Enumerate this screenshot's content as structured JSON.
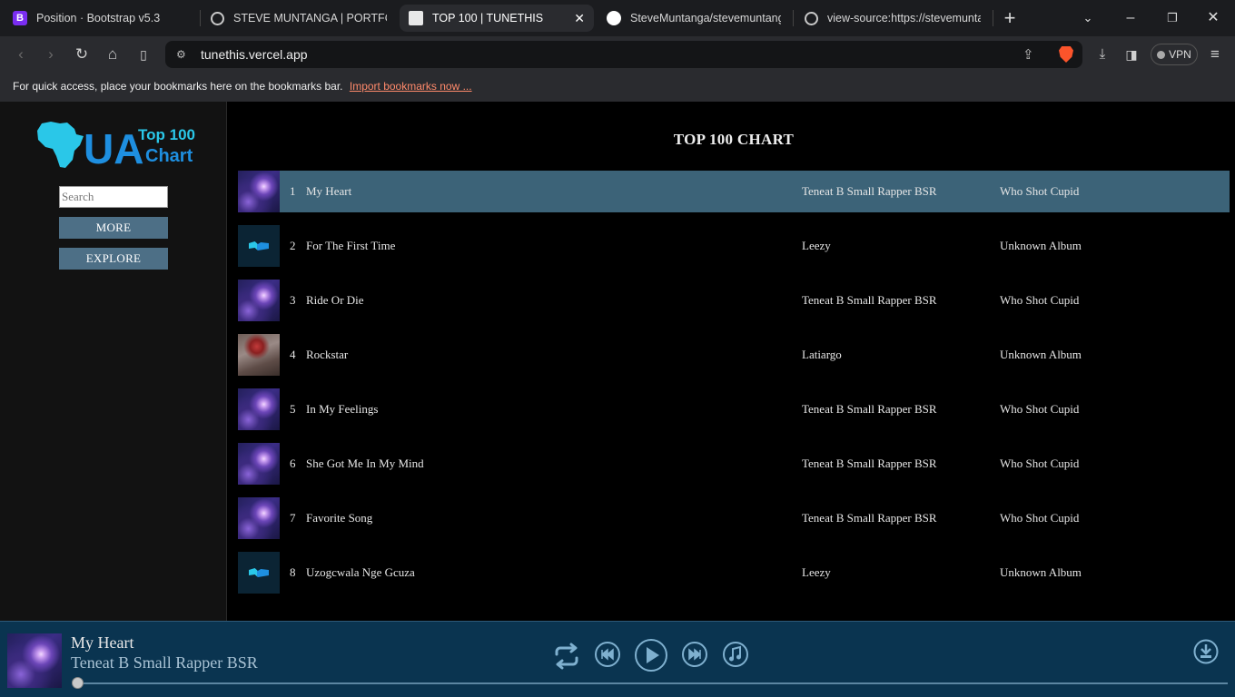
{
  "browser": {
    "tabs": [
      {
        "title": "Position · Bootstrap v5.3",
        "icon": "bootstrap-icon"
      },
      {
        "title": "STEVE MUNTANGA | PORTFOLIO",
        "icon": "globe-icon"
      },
      {
        "title": "TOP 100 | TUNETHIS",
        "icon": "site-icon",
        "active": true
      },
      {
        "title": "SteveMuntanga/stevemuntanga",
        "icon": "github-icon"
      },
      {
        "title": "view-source:https://stevemuntang",
        "icon": "globe-icon"
      }
    ],
    "url": "tunethis.vercel.app",
    "vpn_label": "VPN",
    "bookmarks_text": "For quick access, place your bookmarks here on the bookmarks bar.",
    "bookmarks_link": "Import bookmarks now ..."
  },
  "sidebar": {
    "logo": {
      "letters": "UA",
      "line1": "Top 100",
      "line2": "Chart"
    },
    "search_placeholder": "Search",
    "buttons": [
      "MORE",
      "EXPLORE"
    ]
  },
  "main": {
    "title": "TOP 100 CHART",
    "tracks": [
      {
        "num": "1",
        "title": "My Heart",
        "artist": "Teneat B Small Rapper BSR",
        "album": "Who Shot Cupid",
        "art": "galaxy",
        "active": true
      },
      {
        "num": "2",
        "title": "For The First Time",
        "artist": "Leezy",
        "album": "Unknown Album",
        "art": "logo"
      },
      {
        "num": "3",
        "title": "Ride Or Die",
        "artist": "Teneat B Small Rapper BSR",
        "album": "Who Shot Cupid",
        "art": "galaxy"
      },
      {
        "num": "4",
        "title": "Rockstar",
        "artist": "Latiargo",
        "album": "Unknown Album",
        "art": "rock"
      },
      {
        "num": "5",
        "title": "In My Feelings",
        "artist": "Teneat B Small Rapper BSR",
        "album": "Who Shot Cupid",
        "art": "galaxy"
      },
      {
        "num": "6",
        "title": "She Got Me In My Mind",
        "artist": "Teneat B Small Rapper BSR",
        "album": "Who Shot Cupid",
        "art": "galaxy"
      },
      {
        "num": "7",
        "title": "Favorite Song",
        "artist": "Teneat B Small Rapper BSR",
        "album": "Who Shot Cupid",
        "art": "galaxy"
      },
      {
        "num": "8",
        "title": "Uzogcwala Nge Gcuza",
        "artist": "Leezy",
        "album": "Unknown Album",
        "art": "logo"
      }
    ]
  },
  "player": {
    "title": "My Heart",
    "artist": "Teneat B Small Rapper BSR",
    "progress": 0
  },
  "colors": {
    "active_row": "#3c6378",
    "player_bg": "#0a3450",
    "button_bg": "#4d6f86",
    "logo_cyan": "#2ac7e8",
    "logo_blue": "#1e8fe0"
  }
}
